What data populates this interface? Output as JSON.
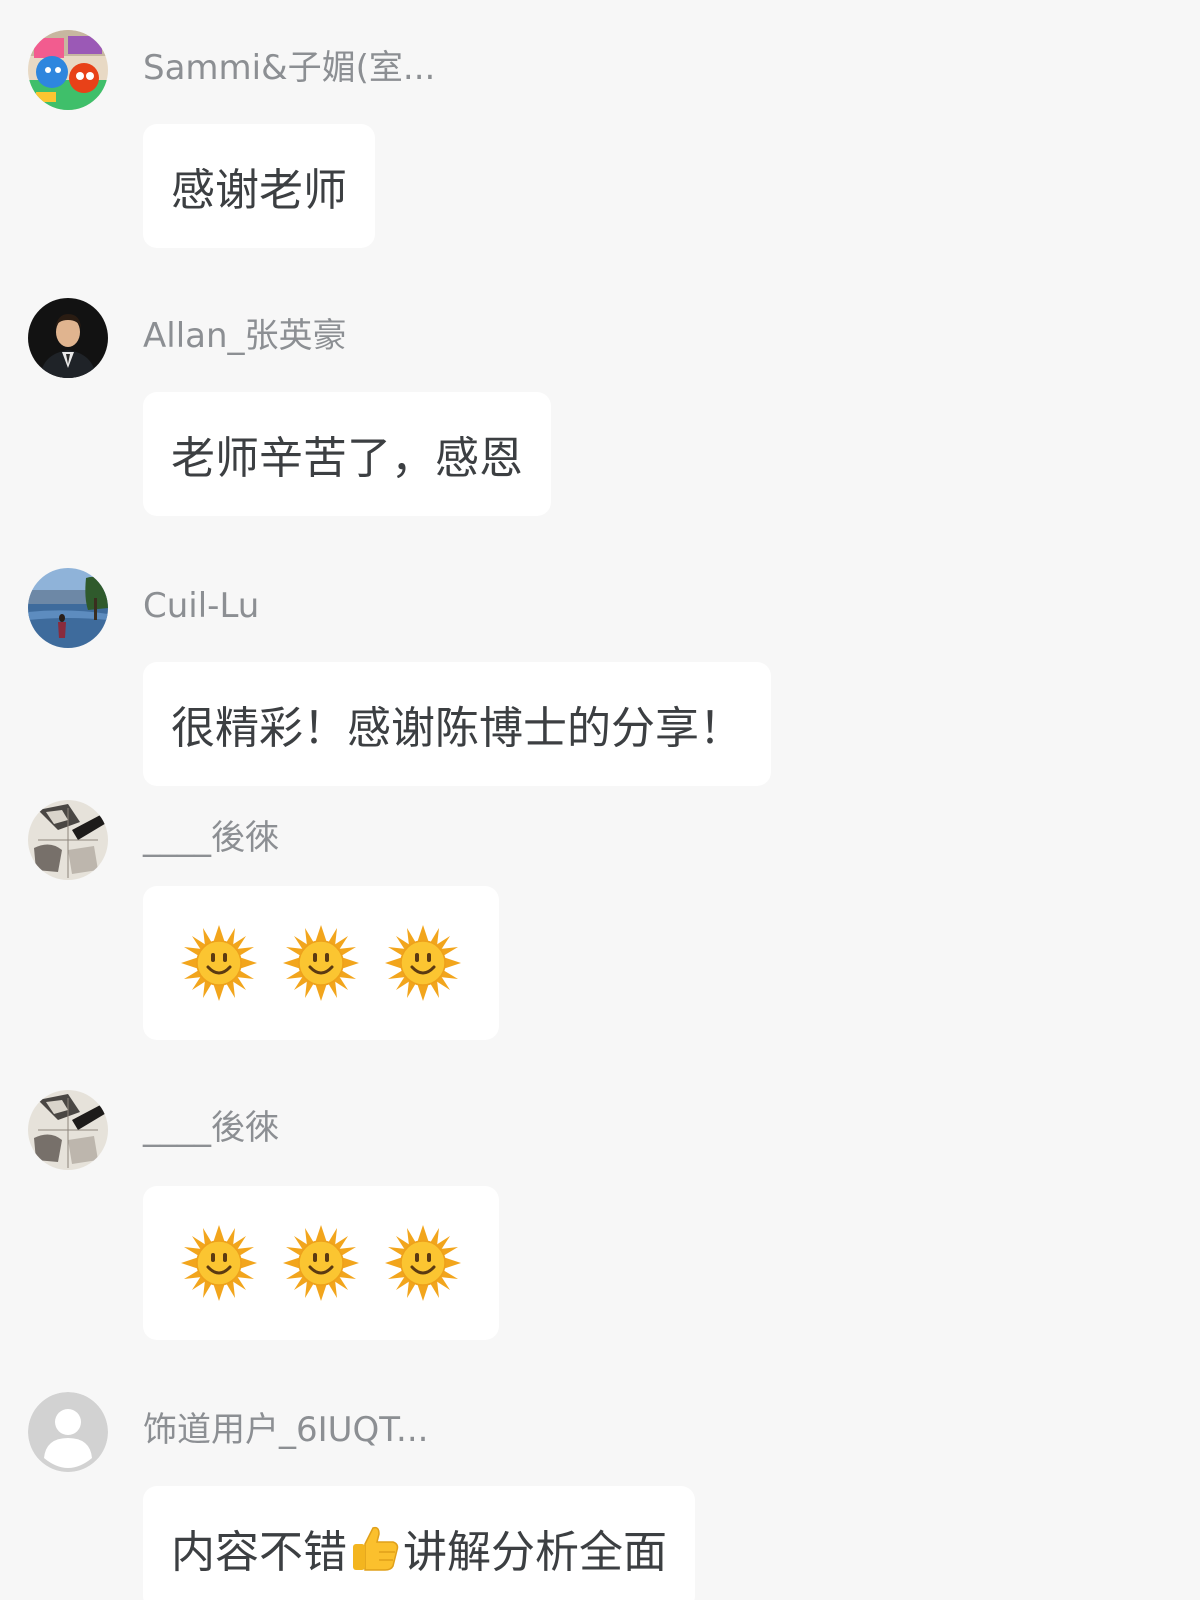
{
  "comments": [
    {
      "name": "Sammi&子媚(室...",
      "text": "感谢老师",
      "avatar": "colorful-sweets-avatar"
    },
    {
      "name": "Allan_张英豪",
      "text": "老师辛苦了，感恩",
      "avatar": "man-portrait-avatar"
    },
    {
      "name": "Cuil-Lu",
      "text": "很精彩！感谢陈博士的分享！",
      "avatar": "lake-scene-avatar"
    },
    {
      "name": "____後徠",
      "emoji": [
        "sun-emoji",
        "sun-emoji",
        "sun-emoji"
      ],
      "avatar": "sketch-artwork-avatar"
    },
    {
      "name": "____後徠",
      "emoji": [
        "sun-emoji",
        "sun-emoji",
        "sun-emoji"
      ],
      "avatar": "sketch-artwork-avatar"
    },
    {
      "name": "饰道用户_6IUQT...",
      "text_before": "内容不错",
      "text_emoji": "thumbs-up-emoji",
      "text_after": "讲解分析全面",
      "avatar": "default-user-avatar"
    }
  ],
  "colors": {
    "background": "#f7f7f7",
    "bubble": "#ffffff",
    "name_text": "#8c8f93",
    "message_text": "#3c3f42",
    "sun": "#f7b52b"
  }
}
